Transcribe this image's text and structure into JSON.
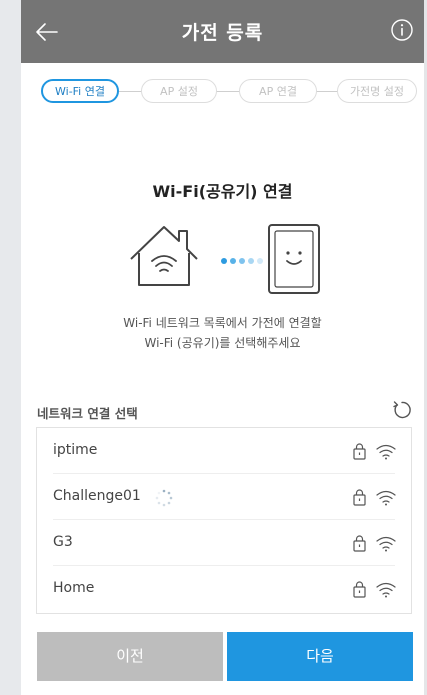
{
  "header": {
    "title": "가전 등록",
    "back_icon": "arrow-left-icon",
    "info_icon": "info-circle-icon"
  },
  "stepper": {
    "steps": [
      {
        "label": "Wi-Fi 연결",
        "active": true
      },
      {
        "label": "AP 설정",
        "active": false
      },
      {
        "label": "AP 연결",
        "active": false
      },
      {
        "label": "가전명 설정",
        "active": false
      }
    ]
  },
  "main": {
    "title": "Wi-Fi(공유기) 연결",
    "description_line1": "Wi-Fi 네트워크 목록에서 가전에 연결할",
    "description_line2": "Wi-Fi (공유기)를 선택해주세요"
  },
  "network_section": {
    "header": "네트워크 연결 선택",
    "refresh_icon": "refresh-icon",
    "networks": [
      {
        "name": "iptime",
        "locked": true,
        "connecting": false
      },
      {
        "name": "Challenge01",
        "locked": true,
        "connecting": true
      },
      {
        "name": "G3",
        "locked": true,
        "connecting": false
      },
      {
        "name": "Home",
        "locked": true,
        "connecting": false
      }
    ]
  },
  "buttons": {
    "prev": "이전",
    "next": "다음"
  },
  "colors": {
    "header_bg": "#757575",
    "accent": "#1f96e0",
    "prev_bg": "#bdbdbd"
  }
}
